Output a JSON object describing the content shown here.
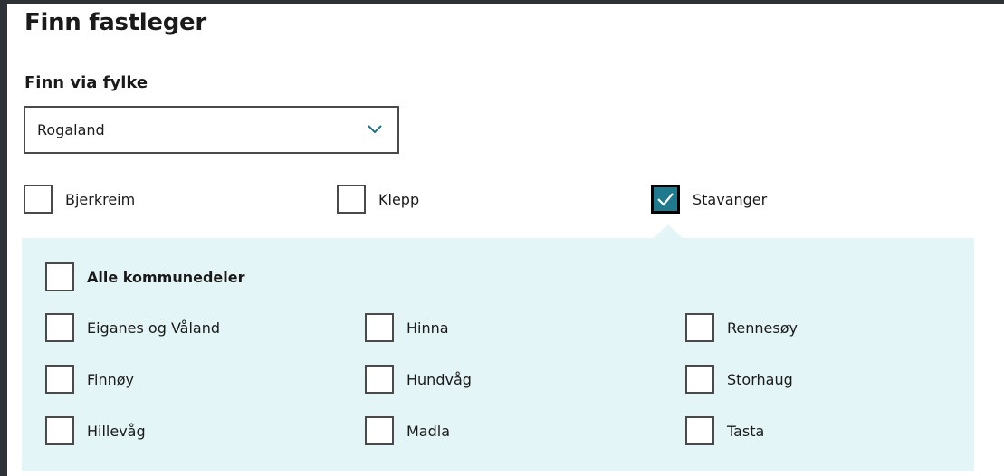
{
  "page": {
    "title": "Finn fastleger"
  },
  "filter": {
    "heading": "Finn via fylke",
    "county_select": {
      "value": "Rogaland",
      "icon": "chevron-down-icon"
    }
  },
  "municipalities": [
    {
      "label": "Bjerkreim",
      "checked": false
    },
    {
      "label": "Klepp",
      "checked": false
    },
    {
      "label": "Stavanger",
      "checked": true
    }
  ],
  "districts_panel": {
    "all_label": "Alle kommunedeler",
    "all_checked": false,
    "columns": [
      [
        {
          "label": "Eiganes og Våland",
          "checked": false
        },
        {
          "label": "Finnøy",
          "checked": false
        },
        {
          "label": "Hillevåg",
          "checked": false
        }
      ],
      [
        {
          "label": "Hinna",
          "checked": false
        },
        {
          "label": "Hundvåg",
          "checked": false
        },
        {
          "label": "Madla",
          "checked": false
        }
      ],
      [
        {
          "label": "Rennesøy",
          "checked": false
        },
        {
          "label": "Storhaug",
          "checked": false
        },
        {
          "label": "Tasta",
          "checked": false
        }
      ]
    ]
  },
  "colors": {
    "accent": "#1e7a8c",
    "panel_bg": "#e4f5f7",
    "border": "#4a4a4a",
    "backdrop": "#2e3237"
  }
}
